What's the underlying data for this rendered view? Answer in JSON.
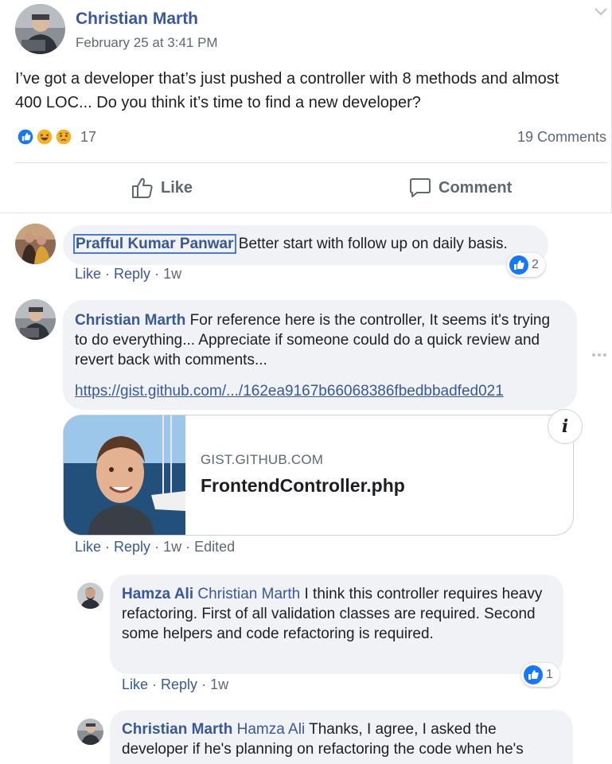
{
  "post": {
    "author": "Christian Marth",
    "date": "February 25 at 3:41 PM",
    "text": "I’ve got a developer that’s just pushed a controller with 8 methods and almost 400 LOC... Do you think it’s time to find a new developer?",
    "reaction_icons": [
      "like-icon",
      "haha-icon",
      "sad-icon"
    ],
    "reaction_count": "17",
    "comments_count": "19 Comments",
    "like_label": "Like",
    "comment_label": "Comment"
  },
  "comments": [
    {
      "author": "Prafful Kumar Panwar",
      "text": "Better start with follow up on daily basis.",
      "like_label": "Like",
      "reply_label": "Reply",
      "time": "1w",
      "reaction_count": "2"
    },
    {
      "author": "Christian Marth",
      "text": "For reference here is the controller, It seems it's trying to do everything... Appreciate if someone could do a quick review and revert back with comments...",
      "link_text": "https://gist.github.com/.../162ea9167b66068386fbedbbadfed021",
      "link_preview": {
        "domain": "GIST.GITHUB.COM",
        "title": "FrontendController.php",
        "info_label": "i"
      },
      "like_label": "Like",
      "reply_label": "Reply",
      "time": "1w",
      "edited": "Edited"
    }
  ],
  "replies": [
    {
      "author": "Hamza Ali",
      "mention": "Christian Marth",
      "text": "I think this controller requires heavy refactoring. First of all validation classes are required. Second some helpers and code refactoring is required.",
      "like_label": "Like",
      "reply_label": "Reply",
      "time": "1w",
      "reaction_count": "1"
    },
    {
      "author": "Christian Marth",
      "mention": "Hamza Ali",
      "text": "Thanks, I agree, I asked the developer if he's planning on refactoring the code when he's"
    }
  ],
  "colors": {
    "link_blue": "#385898",
    "like_blue": "#1877f2",
    "bubble_bg": "#f0f2f5",
    "muted_text": "#606770"
  }
}
